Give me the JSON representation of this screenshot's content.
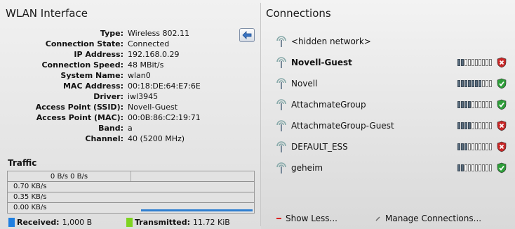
{
  "left": {
    "title": "WLAN Interface",
    "info": [
      {
        "key": "Type:",
        "value": "Wireless 802.11"
      },
      {
        "key": "Connection State:",
        "value": "Connected"
      },
      {
        "key": "IP Address:",
        "value": "192.168.0.29"
      },
      {
        "key": "Connection Speed:",
        "value": "48 MBit/s"
      },
      {
        "key": "System Name:",
        "value": "wlan0"
      },
      {
        "key": "MAC Address:",
        "value": "00:18:DE:64:E7:6E"
      },
      {
        "key": "Driver:",
        "value": "iwl3945"
      },
      {
        "key": "Access Point (SSID):",
        "value": "Novell-Guest"
      },
      {
        "key": "Access Point (MAC):",
        "value": "00:0B:86:C2:19:71"
      },
      {
        "key": "Band:",
        "value": "a"
      },
      {
        "key": "Channel:",
        "value": "40 (5200 MHz)"
      }
    ],
    "back_icon": "back-arrow-icon",
    "traffic": {
      "title": "Traffic",
      "top_label": "0 B/s 0 B/s",
      "levels": [
        "0.70 KB/s",
        "0.35 KB/s",
        "0.00 KB/s"
      ],
      "received_label": "Received:",
      "received_value": "1,000 B",
      "transmitted_label": "Transmitted:",
      "transmitted_value": "11.72 KiB",
      "received_color": "#1f7fe0",
      "transmitted_color": "#7ed321"
    }
  },
  "right": {
    "title": "Connections",
    "networks": [
      {
        "name": "<hidden network>",
        "bold": false,
        "signal": null,
        "secure": null
      },
      {
        "name": "Novell-Guest",
        "bold": true,
        "signal": 2,
        "secure": false
      },
      {
        "name": "Novell",
        "bold": false,
        "signal": 7,
        "secure": true
      },
      {
        "name": "AttachmateGroup",
        "bold": false,
        "signal": 4,
        "secure": true
      },
      {
        "name": "AttachmateGroup-Guest",
        "bold": false,
        "signal": 4,
        "secure": false
      },
      {
        "name": "DEFAULT_ESS",
        "bold": false,
        "signal": 3,
        "secure": false
      },
      {
        "name": "geheim",
        "bold": false,
        "signal": 2,
        "secure": true
      }
    ],
    "show_less": "Show Less...",
    "manage": "Manage Connections..."
  }
}
